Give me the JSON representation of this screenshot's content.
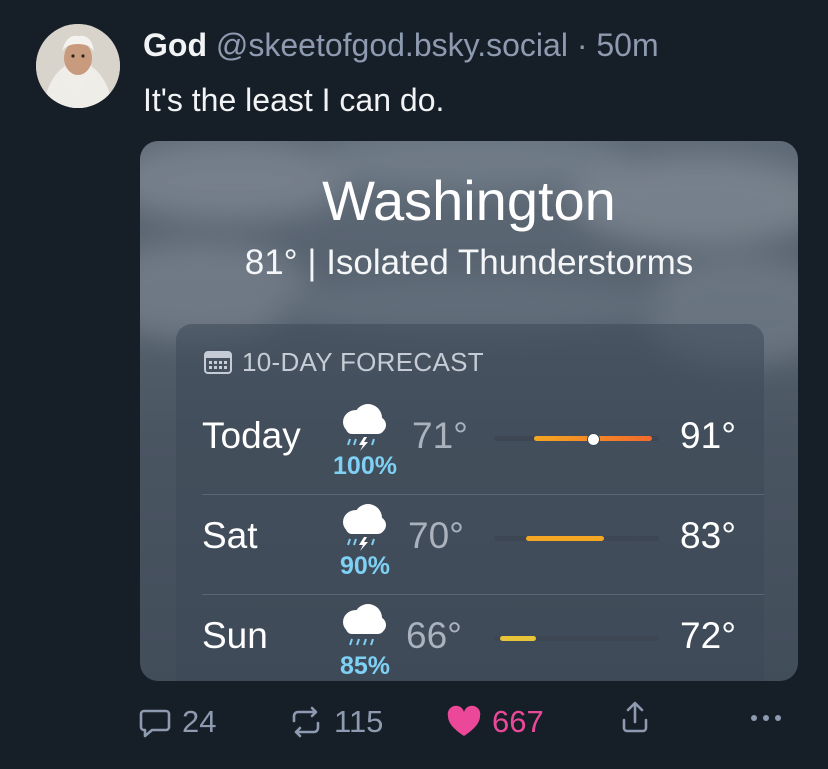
{
  "post": {
    "author_name": "God",
    "handle": "@skeetofgod.bsky.social",
    "separator": "·",
    "time": "50m",
    "text": "It's the least I can do."
  },
  "weather": {
    "city": "Washington",
    "conditions": "81° | Isolated Thunderstorms",
    "panel_title": "10-DAY FORECAST",
    "days": [
      {
        "day": "Today",
        "icon": "thunderstorm-icon",
        "precip": "100%",
        "low": "71°",
        "high": "91°",
        "low_value": 71,
        "high_value": 91,
        "current_value": 81
      },
      {
        "day": "Sat",
        "icon": "thunderstorm-icon",
        "precip": "90%",
        "low": "70°",
        "high": "83°",
        "low_value": 70,
        "high_value": 83
      },
      {
        "day": "Sun",
        "icon": "rain-icon",
        "precip": "85%",
        "low": "66°",
        "high": "72°",
        "low_value": 66,
        "high_value": 72
      }
    ],
    "colors": {
      "precip": "#7fd0f5",
      "bar_warm": "#f5a623",
      "bar_hot": "#f26a2b",
      "bar_mild": "#e8c43a"
    }
  },
  "actions": {
    "replies": "24",
    "reposts": "115",
    "likes": "667",
    "like_color": "#ec4899"
  }
}
